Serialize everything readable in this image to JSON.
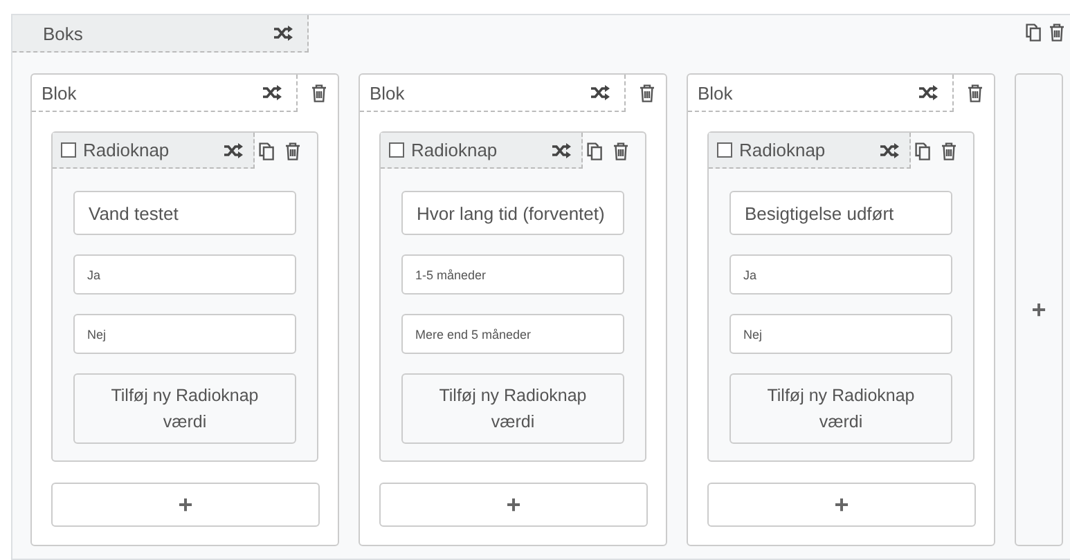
{
  "box": {
    "title": "Boks"
  },
  "blocks": [
    {
      "title": "Blok",
      "radio": {
        "label": "Radioknap",
        "checked": false,
        "question": "Vand testet",
        "options": [
          "Ja",
          "Nej"
        ],
        "add_label": "Tilføj ny Radioknap værdi"
      },
      "add_button": "+"
    },
    {
      "title": "Blok",
      "radio": {
        "label": "Radioknap",
        "checked": false,
        "question": "Hvor lang tid (forventet)",
        "options": [
          "1-5 måneder",
          "Mere end 5 måneder"
        ],
        "add_label": "Tilføj ny Radioknap værdi"
      },
      "add_button": "+"
    },
    {
      "title": "Blok",
      "radio": {
        "label": "Radioknap",
        "checked": false,
        "question": "Besigtigelse udført",
        "options": [
          "Ja",
          "Nej"
        ],
        "add_label": "Tilføj ny Radioknap værdi"
      },
      "add_button": "+"
    }
  ],
  "add_block_button": "+"
}
